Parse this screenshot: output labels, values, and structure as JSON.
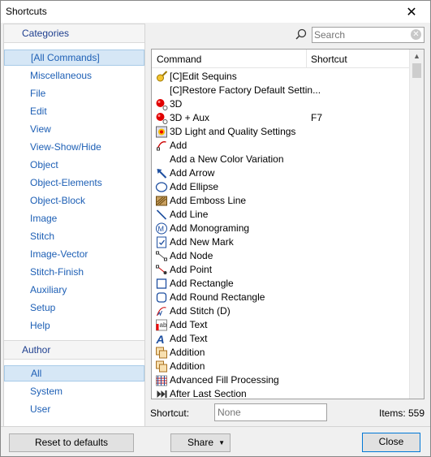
{
  "window": {
    "title": "Shortcuts"
  },
  "sidebar": {
    "categories_header": "Categories",
    "categories": [
      {
        "label": "[All Commands]",
        "selected": true
      },
      {
        "label": "Miscellaneous"
      },
      {
        "label": "File"
      },
      {
        "label": "Edit"
      },
      {
        "label": "View"
      },
      {
        "label": "View-Show/Hide"
      },
      {
        "label": "Object"
      },
      {
        "label": "Object-Elements"
      },
      {
        "label": "Object-Block"
      },
      {
        "label": "Image"
      },
      {
        "label": "Stitch"
      },
      {
        "label": "Image-Vector"
      },
      {
        "label": "Stitch-Finish"
      },
      {
        "label": "Auxiliary"
      },
      {
        "label": "Setup"
      },
      {
        "label": "Help"
      }
    ],
    "author_header": "Author",
    "authors": [
      {
        "label": "All",
        "selected": true
      },
      {
        "label": "System"
      },
      {
        "label": "User"
      }
    ]
  },
  "search": {
    "placeholder": "Search",
    "value": ""
  },
  "list": {
    "columns": {
      "command": "Command",
      "shortcut": "Shortcut"
    },
    "rows": [
      {
        "icon": "key-icon",
        "name": "[C]Edit Sequins",
        "shortcut": ""
      },
      {
        "icon": "",
        "name": "[C]Restore Factory Default Settin...",
        "shortcut": ""
      },
      {
        "icon": "red-ball-icon",
        "name": "3D",
        "shortcut": ""
      },
      {
        "icon": "red-ball-icon",
        "name": "3D + Aux",
        "shortcut": "F7"
      },
      {
        "icon": "3d-light-icon",
        "name": "3D Light and Quality Settings",
        "shortcut": ""
      },
      {
        "icon": "add-curve-icon",
        "name": "Add",
        "shortcut": ""
      },
      {
        "icon": "",
        "name": "Add a New Color Variation",
        "shortcut": ""
      },
      {
        "icon": "arrow-icon",
        "name": "Add Arrow",
        "shortcut": ""
      },
      {
        "icon": "ellipse-icon",
        "name": "Add Ellipse",
        "shortcut": ""
      },
      {
        "icon": "emboss-icon",
        "name": "Add Emboss Line",
        "shortcut": ""
      },
      {
        "icon": "line-icon",
        "name": "Add Line",
        "shortcut": ""
      },
      {
        "icon": "monogram-icon",
        "name": "Add Monograming",
        "shortcut": ""
      },
      {
        "icon": "mark-icon",
        "name": "Add New Mark",
        "shortcut": ""
      },
      {
        "icon": "node-icon",
        "name": "Add Node",
        "shortcut": ""
      },
      {
        "icon": "point-icon",
        "name": "Add Point",
        "shortcut": ""
      },
      {
        "icon": "rectangle-icon",
        "name": "Add Rectangle",
        "shortcut": ""
      },
      {
        "icon": "round-rectangle-icon",
        "name": "Add Round Rectangle",
        "shortcut": ""
      },
      {
        "icon": "stitch-icon",
        "name": "Add Stitch (D)",
        "shortcut": ""
      },
      {
        "icon": "text-box-icon",
        "name": "Add Text",
        "shortcut": ""
      },
      {
        "icon": "text-a-icon",
        "name": "Add Text",
        "shortcut": ""
      },
      {
        "icon": "addition-icon",
        "name": "Addition",
        "shortcut": ""
      },
      {
        "icon": "addition-icon",
        "name": "Addition",
        "shortcut": ""
      },
      {
        "icon": "fill-processing-icon",
        "name": "Advanced Fill Processing",
        "shortcut": ""
      },
      {
        "icon": "skip-end-icon",
        "name": "After Last Section",
        "shortcut": ""
      }
    ]
  },
  "bottom": {
    "shortcut_label": "Shortcut:",
    "shortcut_placeholder": "None",
    "items_count": "Items: 559"
  },
  "footer": {
    "reset_label": "Reset to defaults",
    "share_label": "Share",
    "close_label": "Close"
  }
}
